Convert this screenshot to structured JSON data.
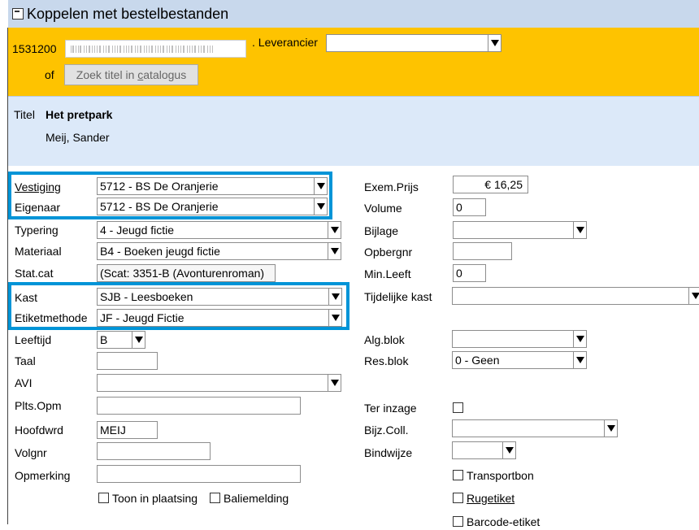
{
  "window": {
    "title": "Koppelen met bestelbestanden"
  },
  "header": {
    "item_number": "1531200",
    "leverancier_label": ". Leverancier",
    "of_label": "of",
    "search_button": "Zoek titel in catalogus",
    "search_button_key": "c"
  },
  "title_block": {
    "titel_label": "Titel",
    "title": "Het pretpark",
    "author": "Meij, Sander"
  },
  "left": {
    "vestiging": {
      "label": "Vestiging",
      "value": "5712 - BS De Oranjerie"
    },
    "eigenaar": {
      "label": "Eigenaar",
      "value": "5712 - BS De Oranjerie"
    },
    "typering": {
      "label": "Typering",
      "value": "4 - Jeugd fictie"
    },
    "materiaal": {
      "label": "Materiaal",
      "value": "B4 - Boeken jeugd fictie"
    },
    "statcat": {
      "label": "Stat.cat",
      "value": "(Scat: 3351-B (Avonturenroman)"
    },
    "kast": {
      "label": "Kast",
      "value": "SJB - Leesboeken"
    },
    "etiketmethode": {
      "label": "Etiketmethode",
      "value": "JF - Jeugd Fictie"
    },
    "leeftijd": {
      "label": "Leeftijd",
      "value": "B"
    },
    "taal": {
      "label": "Taal",
      "value": ""
    },
    "avi": {
      "label": "AVI",
      "value": ""
    },
    "pltsopm": {
      "label": "Plts.Opm",
      "value": ""
    },
    "hoofdwrd": {
      "label": "Hoofdwrd",
      "value": "MEIJ"
    },
    "volgnr": {
      "label": "Volgnr",
      "value": ""
    },
    "opmerking": {
      "label": "Opmerking",
      "value": ""
    },
    "toon_in_plaatsing": "Toon in plaatsing",
    "baliemelding": "Baliemelding"
  },
  "right": {
    "exemprijs": {
      "label": "Exem.Prijs",
      "value": "€ 16,25"
    },
    "volume": {
      "label": "Volume",
      "value": "0"
    },
    "bijlage": {
      "label": "Bijlage",
      "value": ""
    },
    "opbergnr": {
      "label": "Opbergnr",
      "value": ""
    },
    "minleeft": {
      "label": "Min.Leeft",
      "value": "0"
    },
    "tijdelijke_kast": {
      "label": "Tijdelijke kast",
      "value": ""
    },
    "algblok": {
      "label": "Alg.blok",
      "value": ""
    },
    "resblok": {
      "label": "Res.blok",
      "value": "0 - Geen"
    },
    "ter_inzage": {
      "label": "Ter inzage"
    },
    "bijzcoll": {
      "label": "Bijz.Coll.",
      "value": ""
    },
    "bindwijze": {
      "label": "Bindwijze",
      "value": ""
    },
    "transportbon": "Transportbon",
    "rugetiket": "Rugetiket",
    "barcode_etiket": "Barcode-etiket"
  },
  "colors": {
    "header_yellow": "#fec300",
    "title_blue": "#dce9f9",
    "highlight": "#0094d7"
  }
}
